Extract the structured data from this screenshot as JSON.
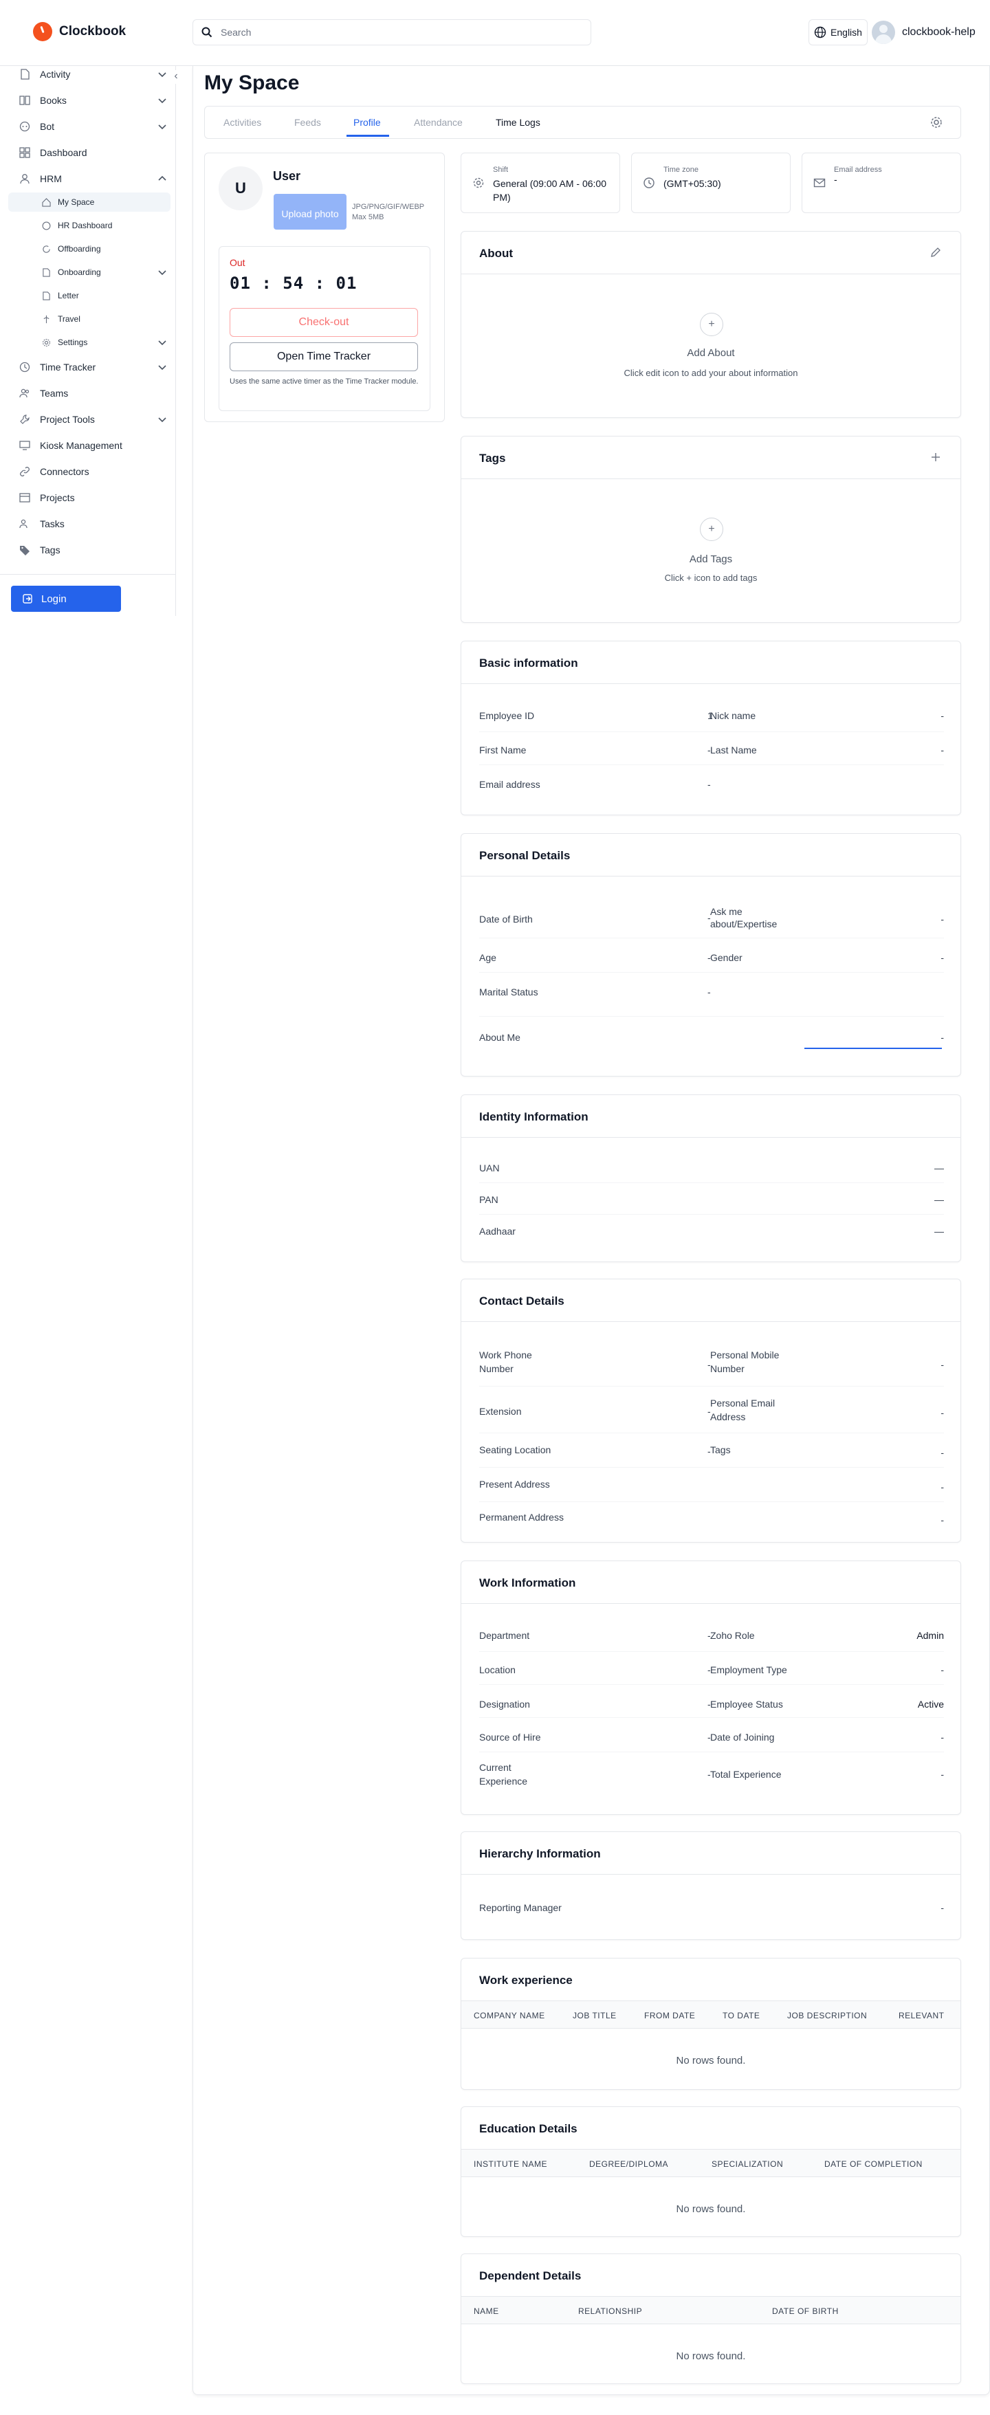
{
  "header": {
    "logo_text": "Clockbook",
    "search_placeholder": "Search",
    "language": "English",
    "username": "clockbook-help"
  },
  "sidebar": {
    "items": [
      {
        "label": "Activity",
        "icon": "file-icon"
      },
      {
        "label": "Books",
        "icon": "books-icon"
      },
      {
        "label": "Bot",
        "icon": "bot-icon"
      },
      {
        "label": "Dashboard",
        "icon": "dashboard-icon"
      },
      {
        "label": "HRM",
        "icon": "user-icon"
      },
      {
        "label": "Time Tracker",
        "icon": "clock-icon"
      },
      {
        "label": "Teams",
        "icon": "teams-icon"
      },
      {
        "label": "Project Tools",
        "icon": "tools-icon"
      },
      {
        "label": "Kiosk Management",
        "icon": "monitor-icon"
      },
      {
        "label": "Connectors",
        "icon": "link-icon"
      },
      {
        "label": "Projects",
        "icon": "projects-icon"
      },
      {
        "label": "Tasks",
        "icon": "tasks-icon"
      },
      {
        "label": "Tags",
        "icon": "tag-icon"
      }
    ],
    "hrm_sub": [
      {
        "label": "My Space",
        "icon": "home-icon"
      },
      {
        "label": "HR Dashboard",
        "icon": "dashboard-icon"
      },
      {
        "label": "Offboarding",
        "icon": "offboarding-icon"
      },
      {
        "label": "Onboarding",
        "icon": "onboarding-icon"
      },
      {
        "label": "Letter",
        "icon": "letter-icon"
      },
      {
        "label": "Travel",
        "icon": "travel-icon"
      },
      {
        "label": "Settings",
        "icon": "gear-icon"
      }
    ],
    "login_label": "Login"
  },
  "page": {
    "title": "My Space",
    "tabs": [
      "Activities",
      "Feeds",
      "Profile",
      "Attendance",
      "Time Logs"
    ]
  },
  "profile": {
    "avatar_initial": "U",
    "name": "User",
    "upload_label": "Upload photo",
    "upload_hint_1": "JPG/PNG/GIF/WEBP",
    "upload_hint_2": "Max 5MB",
    "timer_status": "Out",
    "timer_value": "01 : 54 : 01",
    "checkout_label": "Check-out",
    "tracker_label": "Open Time Tracker",
    "timer_note": "Uses the same active timer as the Time Tracker module."
  },
  "info": {
    "shift_label": "Shift",
    "shift_value": "General (09:00 AM - 06:00 PM)",
    "timezone_label": "Time zone",
    "timezone_value": "(GMT+05:30)",
    "email_label": "Email address",
    "email_value": "-"
  },
  "about": {
    "title": "About",
    "empty_title": "Add About",
    "empty_sub": "Click edit icon to add your about information"
  },
  "tags": {
    "title": "Tags",
    "empty_title": "Add Tags",
    "empty_sub": "Click + icon to add tags"
  },
  "basic": {
    "title": "Basic information",
    "employee_id_label": "Employee ID",
    "employee_id": "1",
    "nick_name_label": "Nick name",
    "nick_name": "-",
    "first_name_label": "First Name",
    "first_name": "-",
    "last_name_label": "Last Name",
    "last_name": "-",
    "email_label": "Email address",
    "email": "-"
  },
  "personal": {
    "title": "Personal Details",
    "dob_label": "Date of Birth",
    "dob": "-",
    "expertise_label": "Ask me about/Expertise",
    "expertise": "-",
    "age_label": "Age",
    "age": "-",
    "gender_label": "Gender",
    "gender": "-",
    "marital_label": "Marital Status",
    "marital": "-",
    "about_me_label": "About Me",
    "about_me": "-"
  },
  "identity": {
    "title": "Identity Information",
    "uan_label": "UAN",
    "uan": "—",
    "pan_label": "PAN",
    "pan": "—",
    "aadhaar_label": "Aadhaar",
    "aadhaar": "—"
  },
  "contact": {
    "title": "Contact Details",
    "work_phone_label": "Work Phone Number",
    "work_phone": "-",
    "personal_mobile_label": "Personal Mobile Number",
    "personal_mobile": "-",
    "extension_label": "Extension",
    "extension": "-",
    "personal_email_label": "Personal Email Address",
    "personal_email": "-",
    "seating_label": "Seating Location",
    "seating": "-",
    "tags_label": "Tags",
    "tags": "-",
    "present_label": "Present Address",
    "present": "-",
    "permanent_label": "Permanent Address",
    "permanent": "-"
  },
  "work": {
    "title": "Work Information",
    "department_label": "Department",
    "department": "-",
    "zoho_role_label": "Zoho Role",
    "zoho_role": "Admin",
    "location_label": "Location",
    "location": "-",
    "employment_type_label": "Employment Type",
    "employment_type": "-",
    "designation_label": "Designation",
    "designation": "-",
    "employee_status_label": "Employee Status",
    "employee_status": "Active",
    "source_label": "Source of Hire",
    "source": "-",
    "doj_label": "Date of Joining",
    "doj": "-",
    "current_exp_label": "Current Experience",
    "current_exp": "-",
    "total_exp_label": "Total Experience",
    "total_exp": "-"
  },
  "hierarchy": {
    "title": "Hierarchy Information",
    "manager_label": "Reporting Manager",
    "manager": "-"
  },
  "work_exp": {
    "title": "Work experience",
    "columns": [
      "COMPANY NAME",
      "JOB TITLE",
      "FROM DATE",
      "TO DATE",
      "JOB DESCRIPTION",
      "RELEVANT"
    ],
    "empty": "No rows found."
  },
  "education": {
    "title": "Education Details",
    "columns": [
      "INSTITUTE NAME",
      "DEGREE/DIPLOMA",
      "SPECIALIZATION",
      "DATE OF COMPLETION"
    ],
    "empty": "No rows found."
  },
  "dependent": {
    "title": "Dependent Details",
    "columns": [
      "NAME",
      "RELATIONSHIP",
      "DATE OF BIRTH"
    ],
    "empty": "No rows found."
  },
  "colors": {
    "primary": "#2563eb",
    "logo": "#f4511e",
    "danger": "#dc2626"
  }
}
